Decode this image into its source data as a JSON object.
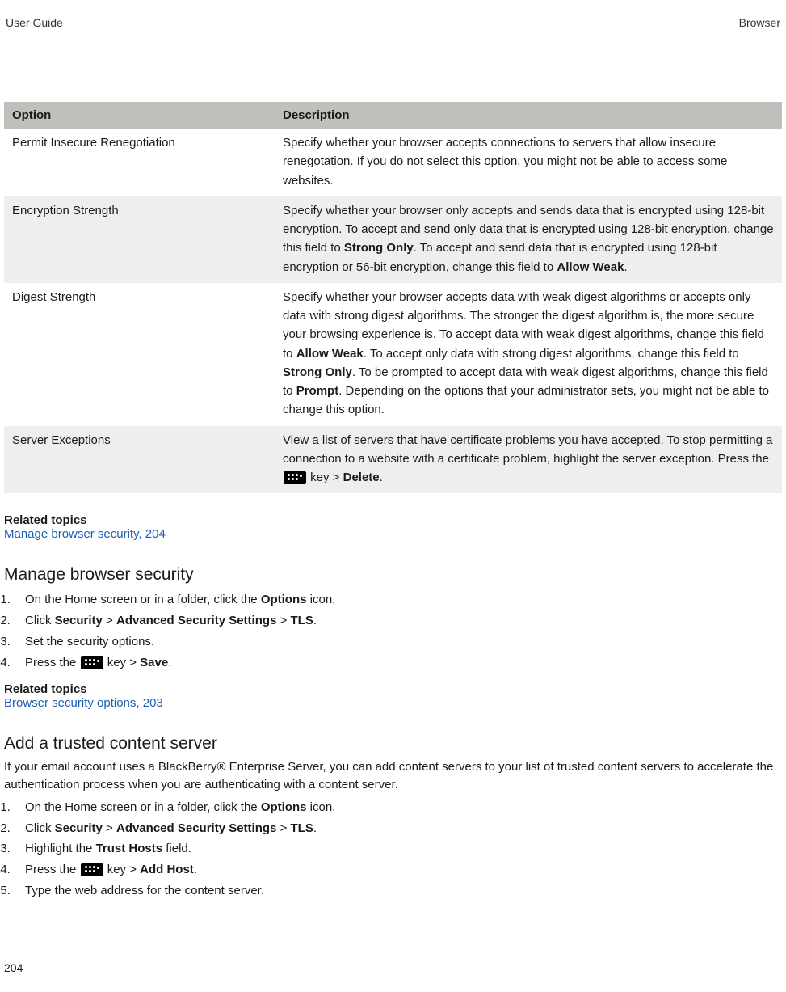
{
  "header": {
    "left": "User Guide",
    "right": "Browser"
  },
  "table": {
    "columns": [
      "Option",
      "Description"
    ],
    "rows": [
      {
        "option": "Permit Insecure Renegotiation",
        "description_html": "Specify whether your browser accepts connections to servers that allow insecure renegotation. If you do not select this option, you might not be able to access some websites."
      },
      {
        "option": "Encryption Strength",
        "description_html": "Specify whether your browser only accepts and sends data that is encrypted using 128-bit encryption. To accept and send only data that is encrypted using 128-bit encryption, change this field to <b>Strong Only</b>. To accept and send data that is encrypted using 128-bit encryption or 56-bit encryption, change this field to <b>Allow Weak</b>."
      },
      {
        "option": "Digest Strength",
        "description_html": "Specify whether your browser accepts data with weak digest algorithms or accepts only data with strong digest algorithms. The stronger the digest algorithm is, the more secure your browsing experience is. To accept data with weak digest algorithms, change this field to <b>Allow Weak</b>. To accept only data with strong digest algorithms, change this field to <b>Strong Only</b>. To be prompted to accept data with weak digest algorithms, change this field to <b>Prompt</b>. Depending on the options that your administrator sets, you might not be able to change this option."
      },
      {
        "option": "Server Exceptions",
        "description_html": "View a list of servers that have certificate problems you have accepted. To stop permitting a connection to a website with a certificate problem, highlight the server exception. Press the {{BB}} key > <b>Delete</b>."
      }
    ]
  },
  "related_1": {
    "label": "Related topics",
    "link_text": "Manage browser security, 204"
  },
  "section_manage": {
    "heading": "Manage browser security",
    "steps": [
      "On the Home screen or in a folder, click the <b>Options</b> icon.",
      "Click <b>Security</b> > <b>Advanced Security Settings</b> > <b>TLS</b>.",
      "Set the security options.",
      "Press the {{BB}} key > <b>Save</b>."
    ]
  },
  "related_2": {
    "label": "Related topics",
    "link_text": "Browser security options, 203"
  },
  "section_trusted": {
    "heading": "Add a trusted content server",
    "intro": "If your email account uses a BlackBerry® Enterprise Server, you can add content servers to your list of trusted content servers to accelerate the authentication process when you are authenticating with a content server.",
    "steps": [
      "On the Home screen or in a folder, click the <b>Options</b> icon.",
      "Click <b>Security</b> > <b>Advanced Security Settings</b> > <b>TLS</b>.",
      "Highlight the <b>Trust Hosts</b> field.",
      "Press the {{BB}} key > <b>Add Host</b>.",
      "Type the web address for the content server."
    ]
  },
  "page_number": "204"
}
